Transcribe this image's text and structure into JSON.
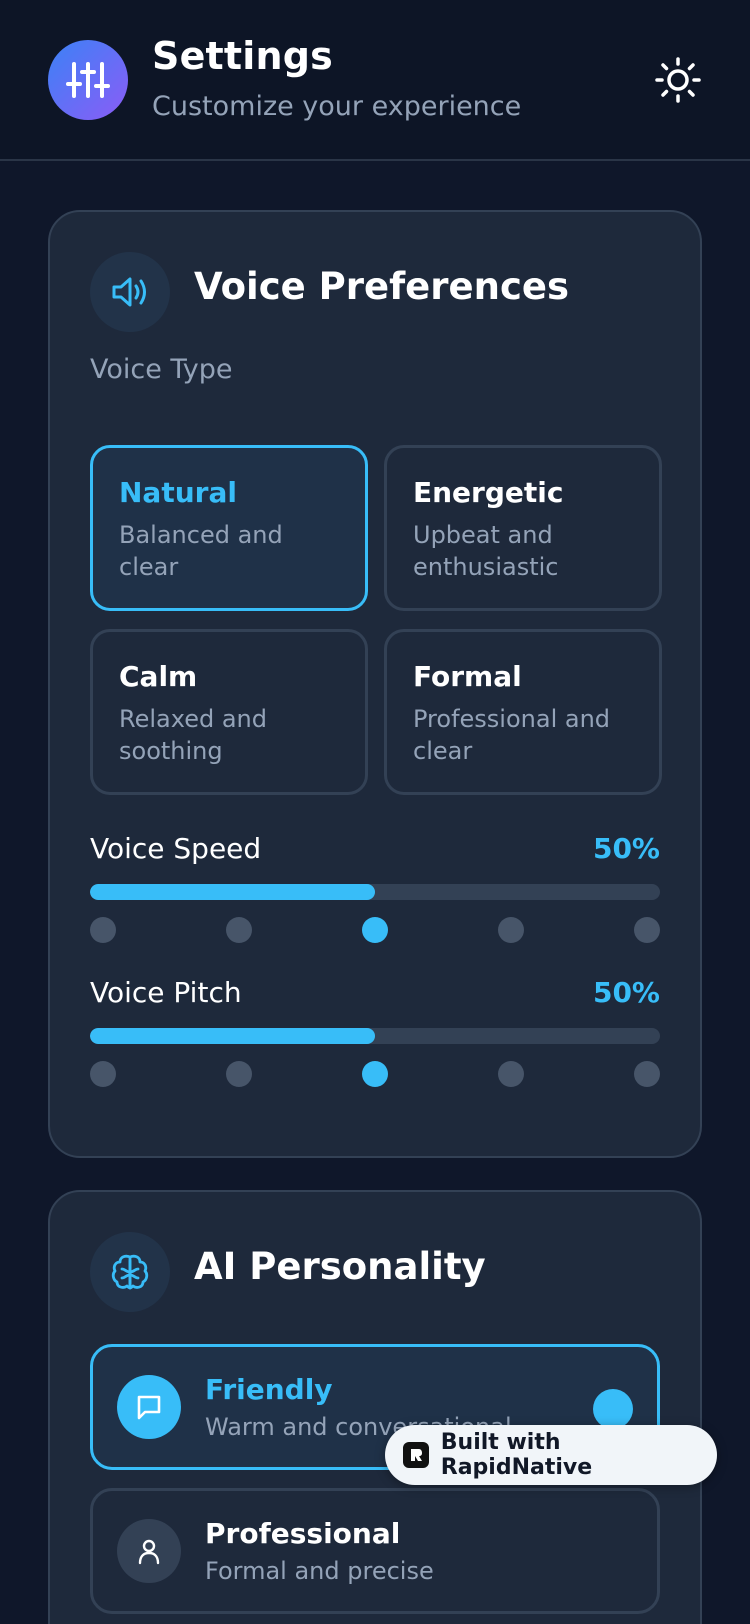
{
  "header": {
    "title": "Settings",
    "subtitle": "Customize your experience",
    "app_icon": "sliders-icon",
    "theme_toggle_icon": "sun-icon"
  },
  "voice_preferences": {
    "title": "Voice Preferences",
    "icon": "speaker-icon",
    "voice_type_label": "Voice Type",
    "options": [
      {
        "title": "Natural",
        "description": "Balanced and clear",
        "selected": true
      },
      {
        "title": "Energetic",
        "description": "Upbeat and enthusiastic",
        "selected": false
      },
      {
        "title": "Calm",
        "description": "Relaxed and soothing",
        "selected": false
      },
      {
        "title": "Formal",
        "description": "Professional and clear",
        "selected": false
      }
    ],
    "speed": {
      "label": "Voice Speed",
      "value_text": "50%",
      "value": 0.5,
      "steps": 5,
      "active_step": 3
    },
    "pitch": {
      "label": "Voice Pitch",
      "value_text": "50%",
      "value": 0.5,
      "steps": 5,
      "active_step": 3
    }
  },
  "ai_personality": {
    "title": "AI Personality",
    "icon": "brain-icon",
    "options": [
      {
        "title": "Friendly",
        "description": "Warm and conversational",
        "icon": "chat-bubble-icon",
        "selected": true
      },
      {
        "title": "Professional",
        "description": "Formal and precise",
        "icon": "person-icon",
        "selected": false
      }
    ]
  },
  "badge": {
    "text": "Built with RapidNative",
    "icon": "rapidnative-logo-icon"
  },
  "colors": {
    "background": "#0f172a",
    "card": "#1e293b",
    "accent": "#38bdf8",
    "muted_text": "#94a3b8",
    "border": "#334155"
  }
}
